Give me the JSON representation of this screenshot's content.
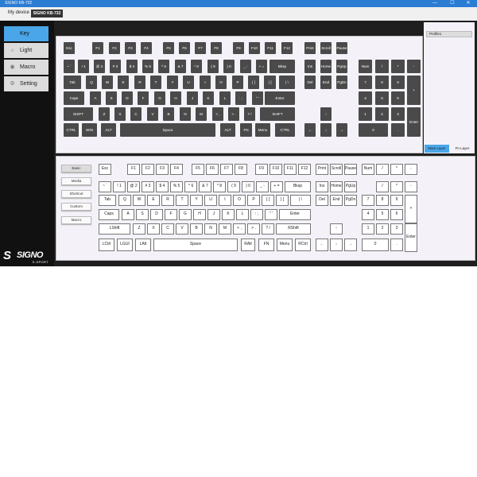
{
  "window": {
    "title": "SIGNO KB-732",
    "min": "—",
    "max": "☐",
    "close": "✕"
  },
  "device_bar": {
    "label": "My device",
    "device_tab": "SIGNO KB-732"
  },
  "sidebar": {
    "items": [
      {
        "label": "Key",
        "icon": "key-icon",
        "active": true
      },
      {
        "label": "Light",
        "icon": "light-icon",
        "active": false
      },
      {
        "label": "Macro",
        "icon": "macro-icon",
        "active": false
      },
      {
        "label": "Setting",
        "icon": "setting-icon",
        "active": false
      }
    ]
  },
  "logo": {
    "mark": "S",
    "text": "SIGNO",
    "sub": "E-SPORT"
  },
  "profile_panel": {
    "profiles": [
      "Profile1"
    ],
    "main_layer": "Main Layer",
    "fn_layer": "Fn Layer"
  },
  "categories": [
    "Basic",
    "Media",
    "Shortcut",
    "Custom",
    "Macro"
  ],
  "selected_category": "Basic",
  "keyboard_keys": [
    "Esc",
    "F1",
    "F2",
    "F3",
    "F4",
    "F5",
    "F6",
    "F7",
    "F8",
    "F9",
    "F10",
    "F11",
    "F12",
    "Print",
    "Scroll",
    "Pause",
    "~ `",
    "! 1",
    "@ 2",
    "# 3",
    "$ 4",
    "% 5",
    "^ 6",
    "& 7",
    "* 8",
    "( 9",
    ") 0",
    "_ -",
    "+ =",
    "Bksp",
    "Ins",
    "Home",
    "PgUp",
    "Num",
    "/",
    "*",
    "-",
    "Tab",
    "Q",
    "W",
    "E",
    "R",
    "T",
    "Y",
    "U",
    "I",
    "O",
    "P",
    "{ [",
    "} ]",
    "| \\",
    "Del",
    "End",
    "PgDn",
    "7",
    "8",
    "9",
    "+",
    "Caps",
    "A",
    "S",
    "D",
    "F",
    "G",
    "H",
    "J",
    "K",
    "L",
    ": ;",
    "\" '",
    "Enter",
    "4",
    "5",
    "6",
    "SHIFT",
    "Z",
    "X",
    "C",
    "V",
    "B",
    "N",
    "M",
    "< ,",
    "> .",
    "? /",
    "SHIFT",
    "↑",
    "1",
    "2",
    "3",
    "Enter",
    "CTRL",
    "WIN",
    "ALT",
    "Space",
    "ALT",
    "FN",
    "Menu",
    "CTRL",
    "←",
    "↓",
    "→",
    "0",
    "."
  ],
  "picker_keys": [
    "Esc",
    "F1",
    "F2",
    "F3",
    "F4",
    "F5",
    "F6",
    "F7",
    "F8",
    "F9",
    "F10",
    "F11",
    "F12",
    "Print",
    "Scroll",
    "Pause",
    "Num",
    "/",
    "*",
    "-",
    "~ `",
    "! 1",
    "@ 2",
    "# 3",
    "$ 4",
    "% 5",
    "^ 6",
    "& 7",
    "* 8",
    "( 9",
    ") 0",
    "_ -",
    "+ =",
    "Bksp",
    "Ins",
    "Home",
    "PgUp",
    "/",
    "*",
    "-",
    "Tab",
    "Q",
    "W",
    "E",
    "R",
    "T",
    "Y",
    "U",
    "I",
    "O",
    "P",
    "{ [",
    "} ]",
    "| \\",
    "Del",
    "End",
    "PgDn",
    "7",
    "8",
    "9",
    "+",
    "Caps",
    "A",
    "S",
    "D",
    "F",
    "G",
    "H",
    "J",
    "K",
    "L",
    ": ;",
    "\" '",
    "Enter",
    "4",
    "5",
    "6",
    "LShift",
    "Z",
    "X",
    "C",
    "V",
    "B",
    "N",
    "M",
    "< ,",
    "> .",
    "? /",
    "RShift",
    "↑",
    "1",
    "2",
    "3",
    "Enter",
    "LCtrl",
    "LGUI",
    "LAlt",
    "Space",
    "RAlt",
    "FN",
    "Menu",
    "RCtrl",
    "←",
    "↓",
    "→",
    "0",
    "."
  ]
}
